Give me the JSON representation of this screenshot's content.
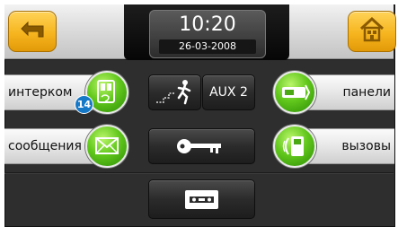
{
  "clock": {
    "time": "10:20",
    "date": "26-03-2008"
  },
  "left_menu": [
    {
      "label": "интерком",
      "icon": "intercom-icon",
      "badge": "14"
    },
    {
      "label": "сообщения",
      "icon": "envelope-icon"
    }
  ],
  "right_menu": [
    {
      "label": "панели",
      "icon": "door-panel-icon"
    },
    {
      "label": "вызовы",
      "icon": "phone-call-icon"
    }
  ],
  "center_buttons": {
    "stairs": {
      "icon": "stairs-light-icon"
    },
    "aux": {
      "label": "AUX 2"
    },
    "key": {
      "icon": "key-icon"
    },
    "cassette": {
      "icon": "cassette-icon"
    }
  },
  "icons": {
    "back": "back-arrow-icon",
    "home": "home-icon"
  },
  "colors": {
    "accent_orange": "#f6b51f",
    "green": "#62c81c",
    "badge_blue": "#1679c8",
    "panel": "#2e2e2e"
  }
}
